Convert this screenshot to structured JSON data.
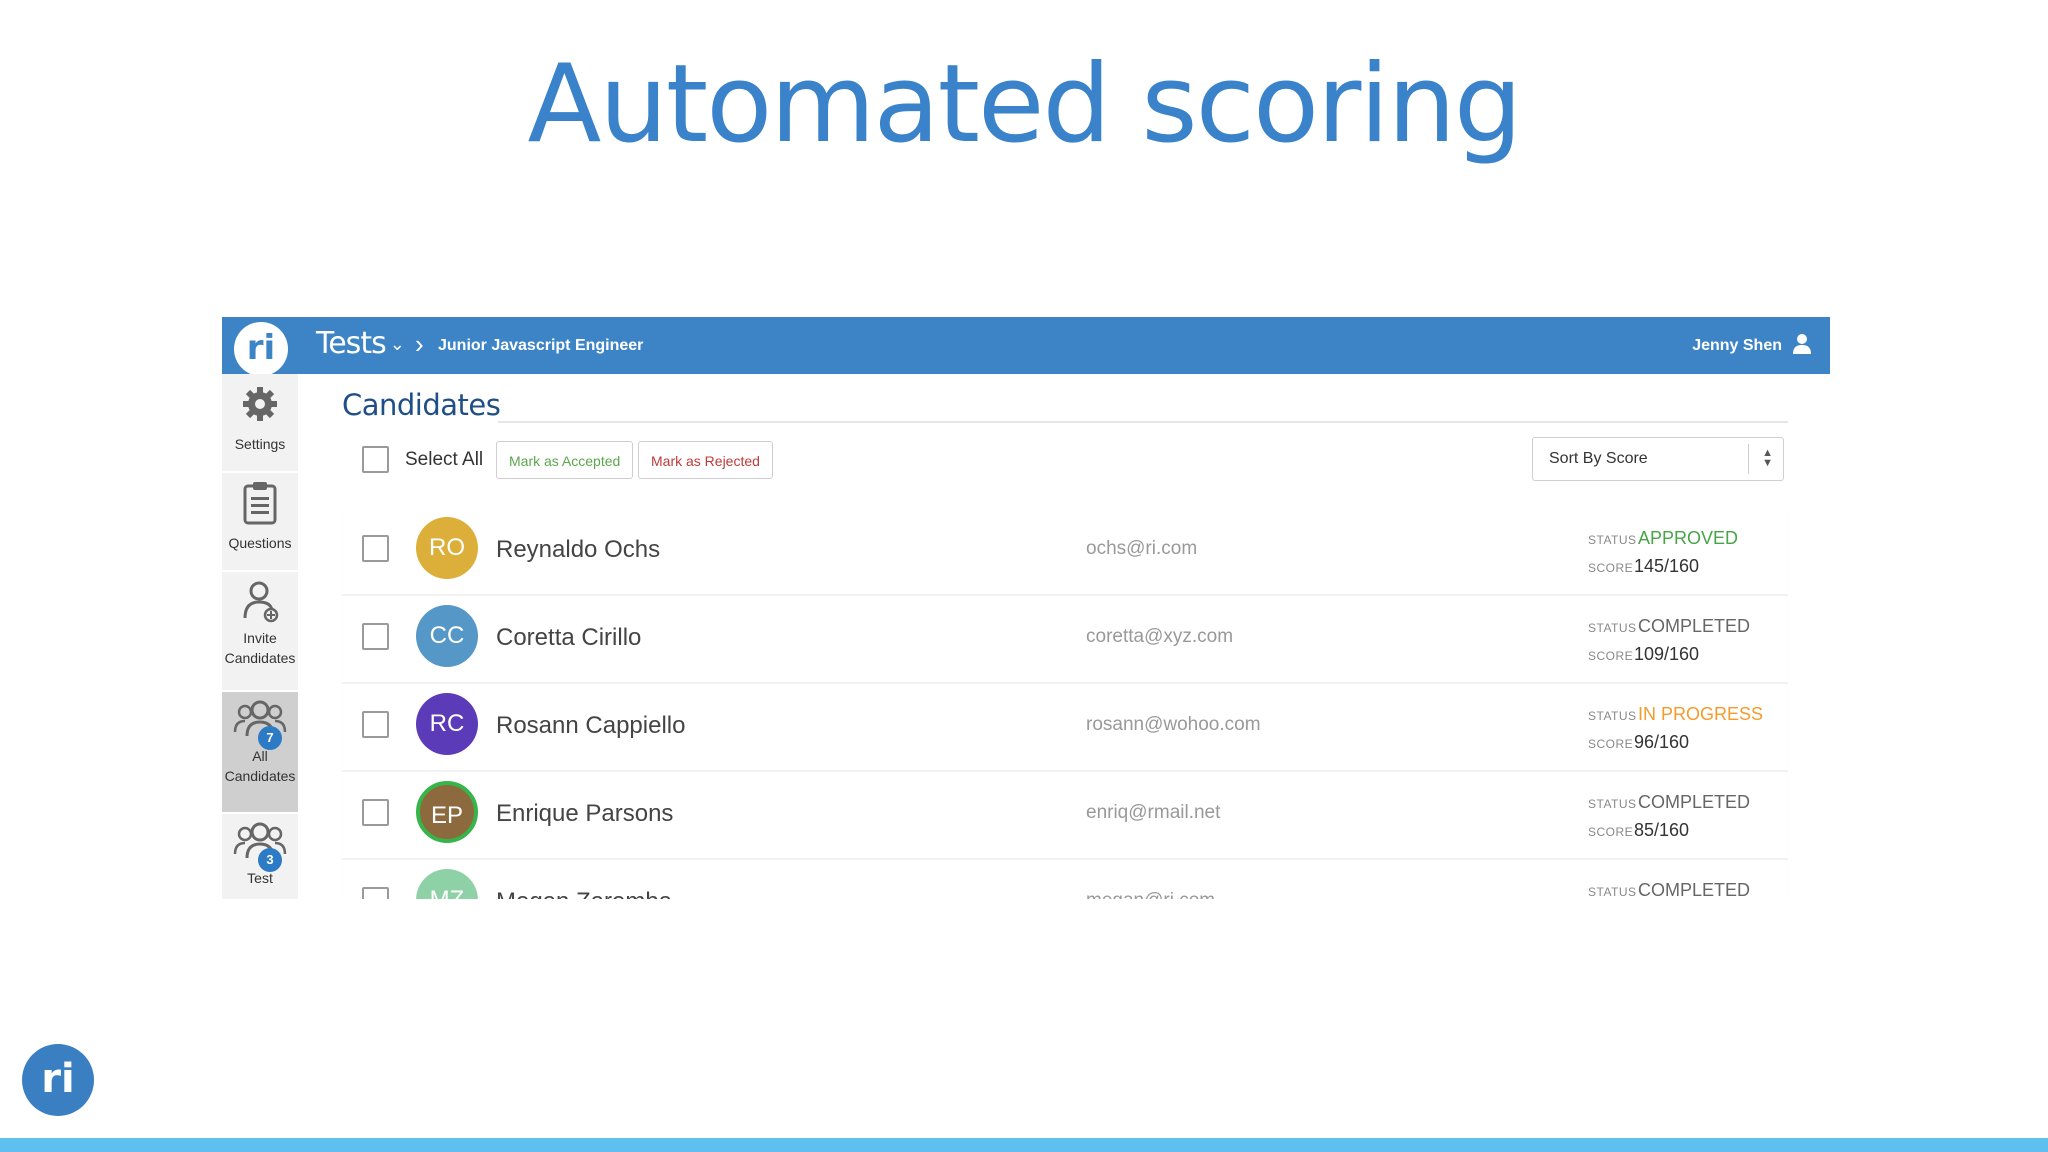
{
  "slide": {
    "title": "Automated scoring"
  },
  "header": {
    "logo": "ri",
    "tests_menu": "Tests",
    "breadcrumb": "Junior Javascript Engineer",
    "user": "Jenny Shen"
  },
  "sidebar": {
    "items": [
      {
        "label": "Settings",
        "icon": "gear-icon"
      },
      {
        "label": "Questions",
        "icon": "clipboard-icon"
      },
      {
        "label": "Invite\nCandidates",
        "icon": "invite-candidates-icon"
      },
      {
        "label": "All\nCandidates",
        "icon": "all-candidates-icon",
        "badge": "7",
        "active": true
      },
      {
        "label": "Test",
        "icon": "test-candidates-icon",
        "badge": "3"
      }
    ]
  },
  "main": {
    "title": "Candidates",
    "select_all": "Select All",
    "mark_accepted": "Mark as Accepted",
    "mark_rejected": "Mark as Rejected",
    "sort": "Sort By Score",
    "status_label": "STATUS",
    "score_label": "SCORE",
    "candidates": [
      {
        "initials": "RO",
        "name": "Reynaldo Ochs",
        "email": "ochs@ri.com",
        "status": "APPROVED",
        "score": "145/160",
        "avatar_color": "#dcae3a",
        "status_color": "#47a447"
      },
      {
        "initials": "CC",
        "name": "Coretta Cirillo",
        "email": "coretta@xyz.com",
        "status": "COMPLETED",
        "score": "109/160",
        "avatar_color": "#5598c8",
        "status_color": "#666666"
      },
      {
        "initials": "RC",
        "name": "Rosann Cappiello",
        "email": "rosann@wohoo.com",
        "status": "IN PROGRESS",
        "score": "96/160",
        "avatar_color": "#5c3bb8",
        "status_color": "#f39c2b"
      },
      {
        "initials": "EP",
        "name": "Enrique Parsons",
        "email": "enriq@rmail.net",
        "status": "COMPLETED",
        "score": "85/160",
        "avatar_color": "#8d6a3e",
        "status_color": "#666666"
      },
      {
        "initials": "MZ",
        "name": "Megan Zaremba",
        "email": "megan@ri.com",
        "status": "COMPLETED",
        "score": "",
        "avatar_color": "#8fd1a6",
        "status_color": "#666666"
      }
    ]
  },
  "colors": {
    "accent": "#3d84c6",
    "title": "#3a82c9",
    "bottom_bar": "#5fc0f0"
  }
}
